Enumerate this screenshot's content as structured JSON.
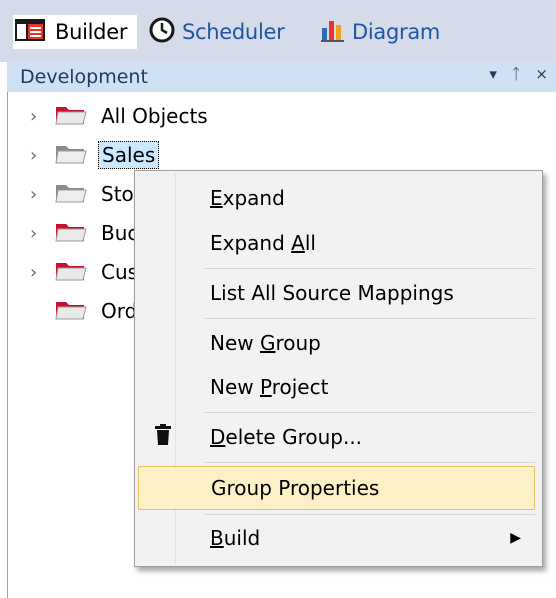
{
  "tabs": [
    {
      "label": "Builder",
      "icon": "builder-icon"
    },
    {
      "label": "Scheduler",
      "icon": "clock-icon"
    },
    {
      "label": "Diagram",
      "icon": "bar-chart-icon"
    }
  ],
  "panel": {
    "title": "Development",
    "buttons": {
      "dropdown": "▾",
      "pin": "ᛏ",
      "close": "×"
    }
  },
  "tree": {
    "items": [
      {
        "label": "All Objects",
        "icon": "red-folder-icon",
        "expandable": true
      },
      {
        "label": "Sales",
        "icon": "grey-folder-icon",
        "expandable": true,
        "selected": true
      },
      {
        "label": "Sto",
        "icon": "grey-folder-icon",
        "expandable": true
      },
      {
        "label": "Buc",
        "icon": "red-folder-icon",
        "expandable": true
      },
      {
        "label": "Cus",
        "icon": "red-folder-icon",
        "expandable": true
      },
      {
        "label": "Ord",
        "icon": "red-folder-icon",
        "expandable": false
      }
    ]
  },
  "context_menu": {
    "items": [
      {
        "pre": "",
        "key": "E",
        "post": "xpand"
      },
      {
        "pre": "Expand ",
        "key": "A",
        "post": "ll"
      },
      {
        "pre": "List All Source Mappings",
        "key": "",
        "post": ""
      },
      {
        "pre": "New ",
        "key": "G",
        "post": "roup"
      },
      {
        "pre": "New ",
        "key": "P",
        "post": "roject"
      },
      {
        "pre": "",
        "key": "D",
        "post": "elete Group...",
        "icon": "trash-icon"
      },
      {
        "pre": "Group Properties",
        "key": "",
        "post": "",
        "highlighted": true
      },
      {
        "pre": "",
        "key": "B",
        "post": "uild",
        "submenu": true
      }
    ]
  },
  "colors": {
    "tabstrip_bg": "#d6dbe9",
    "panel_header_bg": "#cfe1f2",
    "selection_bg": "#cce8ff",
    "menu_highlight_bg": "#fcf0c6",
    "menu_highlight_border": "#e5c365",
    "folder_red": "#c8102e"
  }
}
